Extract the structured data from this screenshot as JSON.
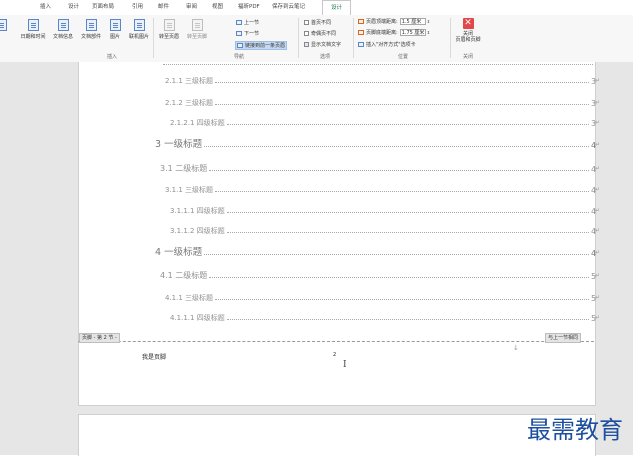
{
  "tabs": [
    {
      "label": "插入"
    },
    {
      "label": "设计"
    },
    {
      "label": "页面布局"
    },
    {
      "label": "引用"
    },
    {
      "label": "邮件"
    },
    {
      "label": "审阅"
    },
    {
      "label": "视图"
    },
    {
      "label": "福昕PDF"
    },
    {
      "label": "保存到云笔记"
    },
    {
      "label": "设计",
      "active": true
    }
  ],
  "ribbon": {
    "insert_group": {
      "label": "插入",
      "buttons": [
        {
          "label": "日期和时间"
        },
        {
          "label": "文档信息"
        },
        {
          "label": "文档部件"
        },
        {
          "label": "图片"
        },
        {
          "label": "联机图片"
        }
      ]
    },
    "nav_group": {
      "label": "导航",
      "buttons": [
        {
          "label": "转至页眉"
        },
        {
          "label": "转至页脚"
        }
      ],
      "items": [
        {
          "label": "上一节"
        },
        {
          "label": "下一节"
        },
        {
          "label": "链接到前一条页眉"
        }
      ]
    },
    "options_group": {
      "label": "选项",
      "items": [
        {
          "label": "首页不同"
        },
        {
          "label": "奇偶页不同"
        },
        {
          "label": "显示文档文字",
          "checked": true
        }
      ]
    },
    "position_group": {
      "label": "位置",
      "header_label": "页眉顶端距离:",
      "header_value": "1.5 厘米",
      "footer_label": "页脚底端距离:",
      "footer_value": "1.75 厘米",
      "align_tab_label": "插入\"对齐方式\"选项卡"
    },
    "close_group": {
      "label": "关闭",
      "close_button": "关闭\n页眉和页脚"
    }
  },
  "toc": [
    {
      "level": 3,
      "text": "2.1.1 三级标题",
      "page": "3"
    },
    {
      "level": 3,
      "text": "2.1.2 三级标题",
      "page": "3"
    },
    {
      "level": 4,
      "text": "2.1.2.1 四级标题",
      "page": "3"
    },
    {
      "level": 1,
      "text": "3 一级标题",
      "page": "4"
    },
    {
      "level": 2,
      "text": "3.1 二级标题",
      "page": "4"
    },
    {
      "level": 3,
      "text": "3.1.1 三级标题",
      "page": "4"
    },
    {
      "level": 4,
      "text": "3.1.1.1 四级标题",
      "page": "4"
    },
    {
      "level": 4,
      "text": "3.1.1.2 四级标题",
      "page": "4"
    },
    {
      "level": 1,
      "text": "4 一级标题",
      "page": "4"
    },
    {
      "level": 2,
      "text": "4.1 二级标题",
      "page": "5"
    },
    {
      "level": 3,
      "text": "4.1.1 三级标题",
      "page": "5"
    },
    {
      "level": 4,
      "text": "4.1.1.1 四级标题",
      "page": "5"
    }
  ],
  "footer": {
    "section_tag": "页脚 - 第 2 节 -",
    "link_tag": "与上一节相同",
    "text": "我是页脚",
    "page_number": "2"
  },
  "watermark": "最需教育",
  "colors": {
    "accent": "#217346",
    "close_red": "#e2474b",
    "watermark": "#1d4fa0"
  }
}
